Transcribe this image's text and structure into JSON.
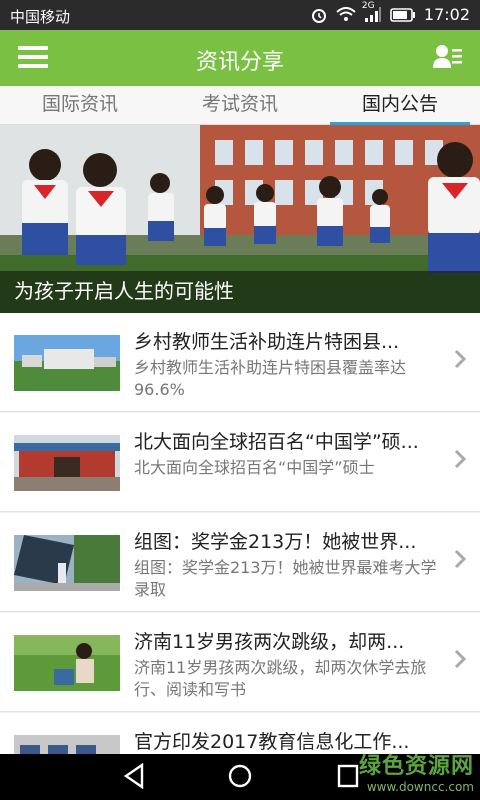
{
  "status_bar": {
    "carrier": "中国移动",
    "network": "2G",
    "time": "17:02"
  },
  "app_bar": {
    "title": "资讯分享",
    "menu_icon": "hamburger-menu-icon",
    "user_icon": "user-list-icon"
  },
  "tabs": [
    {
      "label": "国际资讯",
      "active": false
    },
    {
      "label": "考试资讯",
      "active": false
    },
    {
      "label": "国内公告",
      "active": true
    }
  ],
  "banner": {
    "caption": "为孩子开启人生的可能性"
  },
  "articles": [
    {
      "title": "乡村教师生活补助连片特困县...",
      "summary": "乡村教师生活补助连片特困县覆盖率达96.6%"
    },
    {
      "title": "北大面向全球招百名“中国学”硕...",
      "summary": "北大面向全球招百名“中国学”硕士"
    },
    {
      "title": "组图：奖学金213万！她被世界...",
      "summary": "组图：奖学金213万！她被世界最难考大学录取"
    },
    {
      "title": "济南11岁男孩两次跳级，却两...",
      "summary": "济南11岁男孩两次跳级，却两次休学去旅行、阅读和写书"
    },
    {
      "title": "官方印发2017教育信息化工作...",
      "summary": ""
    }
  ],
  "watermark": {
    "main": "绿色资源网",
    "url": "www.downcc.com"
  },
  "colors": {
    "accent_green": "#7ac143",
    "tab_indicator": "#2fa2d8"
  }
}
